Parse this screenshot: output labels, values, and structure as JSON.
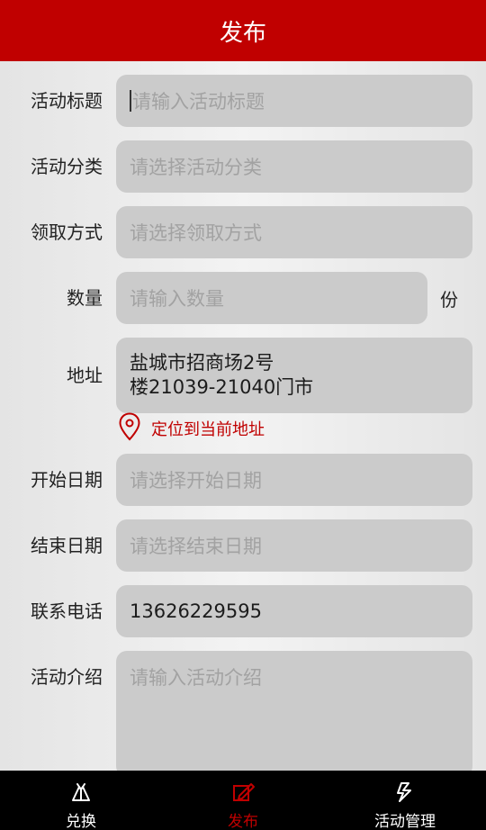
{
  "header": {
    "title": "发布"
  },
  "form": {
    "title": {
      "label": "活动标题",
      "placeholder": "请输入活动标题"
    },
    "category": {
      "label": "活动分类",
      "placeholder": "请选择活动分类"
    },
    "method": {
      "label": "领取方式",
      "placeholder": "请选择领取方式"
    },
    "quantity": {
      "label": "数量",
      "placeholder": "请输入数量",
      "unit": "份"
    },
    "address": {
      "label": "地址",
      "value_line1": "盐城市招商场2号",
      "value_line2": "楼21039-21040门市"
    },
    "locate": {
      "text": "定位到当前地址"
    },
    "start_date": {
      "label": "开始日期",
      "placeholder": "请选择开始日期"
    },
    "end_date": {
      "label": "结束日期",
      "placeholder": "请选择结束日期"
    },
    "phone": {
      "label": "联系电话",
      "value": "13626229595"
    },
    "intro": {
      "label": "活动介绍",
      "placeholder": "请输入活动介绍"
    }
  },
  "tabs": [
    {
      "label": "兑换",
      "icon": "exchange-icon",
      "active": false
    },
    {
      "label": "发布",
      "icon": "edit-icon",
      "active": true
    },
    {
      "label": "活动管理",
      "icon": "manage-icon",
      "active": false
    }
  ],
  "colors": {
    "accent": "#c00000",
    "field_bg": "#cbcbcb",
    "tabbar_bg": "#000000"
  }
}
